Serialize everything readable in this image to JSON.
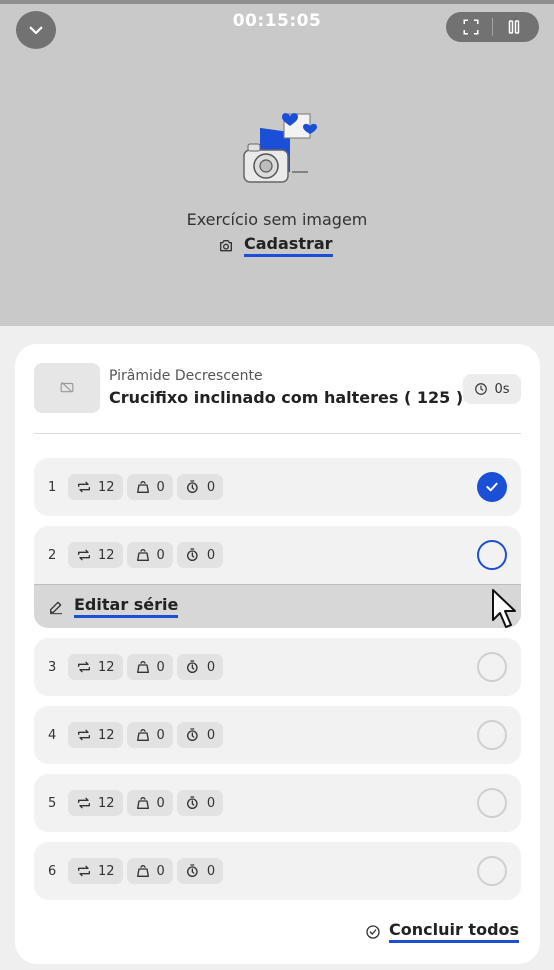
{
  "header": {
    "timer": "00:15:05"
  },
  "media": {
    "no_image_text": "Exercício sem imagem",
    "register_label": "Cadastrar"
  },
  "exercise": {
    "type": "Pirâmide Decrescente",
    "name": "Crucifixo inclinado com halteres ( 125 )",
    "rest": "0s"
  },
  "sets": [
    {
      "number": "1",
      "reps": "12",
      "weight": "0",
      "rest": "0",
      "status": "done"
    },
    {
      "number": "2",
      "reps": "12",
      "weight": "0",
      "rest": "0",
      "status": "current"
    },
    {
      "number": "3",
      "reps": "12",
      "weight": "0",
      "rest": "0",
      "status": "pending"
    },
    {
      "number": "4",
      "reps": "12",
      "weight": "0",
      "rest": "0",
      "status": "pending"
    },
    {
      "number": "5",
      "reps": "12",
      "weight": "0",
      "rest": "0",
      "status": "pending"
    },
    {
      "number": "6",
      "reps": "12",
      "weight": "0",
      "rest": "0",
      "status": "pending"
    }
  ],
  "edit_set_label": "Editar série",
  "conclude_all_label": "Concluir todos",
  "colors": {
    "accent": "#1a4fd6",
    "media_bg": "#c9c9c9",
    "row_bg": "#f2f2f2"
  }
}
